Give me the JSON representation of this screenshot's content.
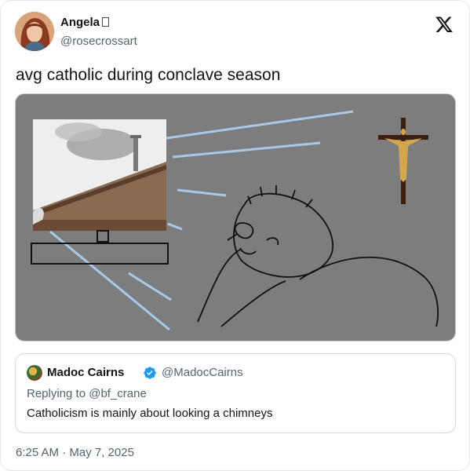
{
  "author": {
    "name": "Angela",
    "handle": "@rosecrossart",
    "avatar_icon": "portrait-avatar"
  },
  "platform_icon": "x-logo-icon",
  "tweet": {
    "text": "avg catholic during conclave season"
  },
  "media": {
    "description_icon": "meme-image",
    "background_color": "#7d7d7d",
    "line_color": "#a9c9e9"
  },
  "quote": {
    "name": "Madoc Cairns",
    "verified_icon": "verified-badge-icon",
    "handle": "@MadocCairns",
    "reply_prefix": "Replying to",
    "reply_to": "@bf_crane",
    "text": "Catholicism is mainly about looking a chimneys"
  },
  "timestamp": "6:25 AM · May 7, 2025",
  "colors": {
    "text_primary": "#0f1419",
    "text_secondary": "#536471",
    "verified": "#1d9bf0",
    "border": "#cfd9de"
  }
}
